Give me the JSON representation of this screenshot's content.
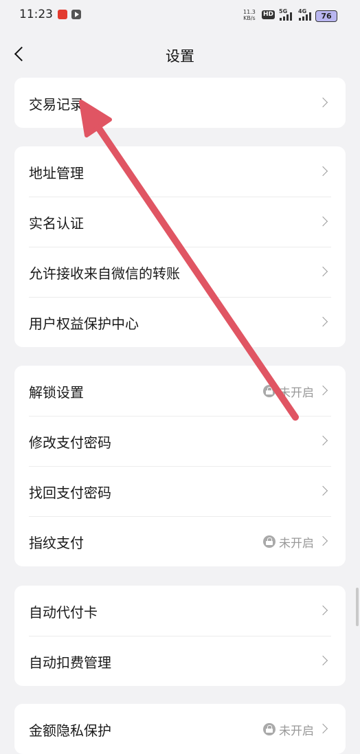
{
  "status_bar": {
    "time": "11:23",
    "speed_value": "11.3",
    "speed_unit": "KB/s",
    "hd": "HD",
    "net1": "5G",
    "net2": "4G",
    "battery": "76"
  },
  "header": {
    "title": "设置"
  },
  "cards": [
    {
      "rows": [
        {
          "label": "交易记录"
        }
      ]
    },
    {
      "rows": [
        {
          "label": "地址管理"
        },
        {
          "label": "实名认证"
        },
        {
          "label": "允许接收来自微信的转账"
        },
        {
          "label": "用户权益保护中心"
        }
      ]
    },
    {
      "rows": [
        {
          "label": "解锁设置",
          "status": "未开启"
        },
        {
          "label": "修改支付密码"
        },
        {
          "label": "找回支付密码"
        },
        {
          "label": "指纹支付",
          "status": "未开启"
        }
      ]
    },
    {
      "rows": [
        {
          "label": "自动代付卡"
        },
        {
          "label": "自动扣费管理"
        }
      ]
    },
    {
      "rows": [
        {
          "label": "金额隐私保护",
          "status": "未开启"
        }
      ]
    }
  ],
  "colors": {
    "background": "#f2f2f4",
    "card": "#ffffff",
    "annotation_arrow": "#e05563"
  },
  "icons": [
    "back-icon",
    "chevron-right-icon",
    "lock-icon",
    "battery-icon",
    "signal-icon"
  ]
}
